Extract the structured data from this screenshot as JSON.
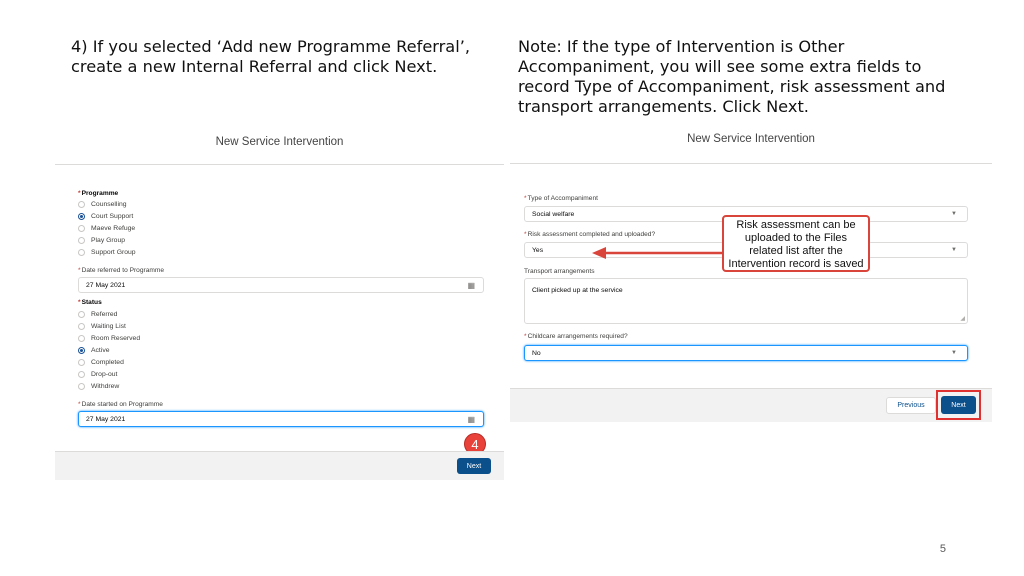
{
  "slide": {
    "left_instruction": "4) If you selected ‘Add new Programme Referral’, create a new Internal Referral and click Next.",
    "right_instruction": "Note: If the type of Intervention is Other Accompaniment, you will see some extra fields to record Type of Accompaniment, risk assessment and transport arrangements. Click Next.",
    "page_number": "5",
    "callout_text": "Risk assessment can be uploaded to the Files related list after the Intervention record is saved",
    "step_badge": "4"
  },
  "left_panel": {
    "title": "New Service Intervention",
    "programme_label": "Programme",
    "programme_options": [
      {
        "label": "Counselling",
        "selected": false
      },
      {
        "label": "Court Support",
        "selected": true
      },
      {
        "label": "Maeve Refuge",
        "selected": false
      },
      {
        "label": "Play Group",
        "selected": false
      },
      {
        "label": "Support Group",
        "selected": false
      }
    ],
    "date_referred_label": "Date referred to Programme",
    "date_referred_value": "27 May 2021",
    "status_label": "Status",
    "status_options": [
      {
        "label": "Referred",
        "selected": false
      },
      {
        "label": "Waiting List",
        "selected": false
      },
      {
        "label": "Room Reserved",
        "selected": false
      },
      {
        "label": "Active",
        "selected": true
      },
      {
        "label": "Completed",
        "selected": false
      },
      {
        "label": "Drop-out",
        "selected": false
      },
      {
        "label": "Withdrew",
        "selected": false
      }
    ],
    "date_started_label": "Date started on Programme",
    "date_started_value": "27 May 2021",
    "next_label": "Next"
  },
  "right_panel": {
    "title": "New Service Intervention",
    "type_label": "Type of Accompaniment",
    "type_value": "Social welfare",
    "risk_label": "Risk assessment completed and uploaded?",
    "risk_value": "Yes",
    "transport_label": "Transport arrangements",
    "transport_value": "Client picked up at the service",
    "childcare_label": "Childcare arrangements required?",
    "childcare_value": "No",
    "previous_label": "Previous",
    "next_label": "Next"
  },
  "colors": {
    "brand_button": "#0b4f8b",
    "highlight_red": "#e03131",
    "required_asterisk": "#c23934"
  },
  "icons": [
    "calendar-icon",
    "chevron-down-icon",
    "arrow-left-icon"
  ]
}
